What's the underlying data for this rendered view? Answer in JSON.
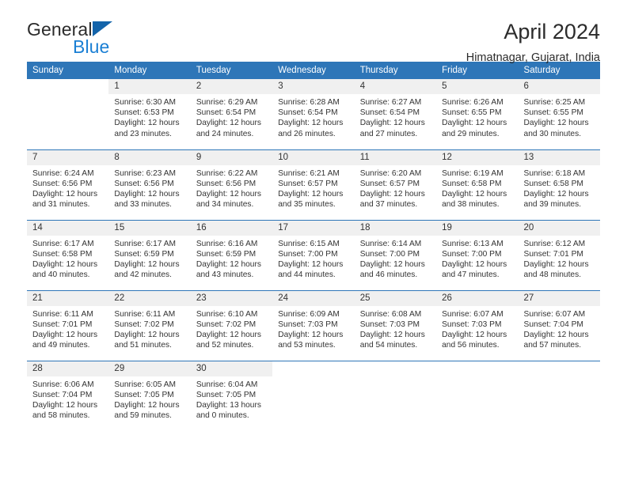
{
  "brand": {
    "name_top": "General",
    "name_bottom": "Blue",
    "triangle_color": "#1464aa",
    "blue_color": "#1a7fd4"
  },
  "header": {
    "title": "April 2024",
    "subtitle": "Himatnagar, Gujarat, India"
  },
  "theme": {
    "header_bg": "#2e76b8",
    "daynum_bg": "#f0f0f0",
    "text": "#333333"
  },
  "weekday_headers": [
    "Sunday",
    "Monday",
    "Tuesday",
    "Wednesday",
    "Thursday",
    "Friday",
    "Saturday"
  ],
  "labels": {
    "sunrise_prefix": "Sunrise:",
    "sunset_prefix": "Sunset:",
    "daylight_prefix": "Daylight:"
  },
  "weeks": [
    [
      {
        "day": ""
      },
      {
        "day": "1",
        "sunrise": "Sunrise: 6:30 AM",
        "sunset": "Sunset: 6:53 PM",
        "daylight_l1": "Daylight: 12 hours",
        "daylight_l2": "and 23 minutes."
      },
      {
        "day": "2",
        "sunrise": "Sunrise: 6:29 AM",
        "sunset": "Sunset: 6:54 PM",
        "daylight_l1": "Daylight: 12 hours",
        "daylight_l2": "and 24 minutes."
      },
      {
        "day": "3",
        "sunrise": "Sunrise: 6:28 AM",
        "sunset": "Sunset: 6:54 PM",
        "daylight_l1": "Daylight: 12 hours",
        "daylight_l2": "and 26 minutes."
      },
      {
        "day": "4",
        "sunrise": "Sunrise: 6:27 AM",
        "sunset": "Sunset: 6:54 PM",
        "daylight_l1": "Daylight: 12 hours",
        "daylight_l2": "and 27 minutes."
      },
      {
        "day": "5",
        "sunrise": "Sunrise: 6:26 AM",
        "sunset": "Sunset: 6:55 PM",
        "daylight_l1": "Daylight: 12 hours",
        "daylight_l2": "and 29 minutes."
      },
      {
        "day": "6",
        "sunrise": "Sunrise: 6:25 AM",
        "sunset": "Sunset: 6:55 PM",
        "daylight_l1": "Daylight: 12 hours",
        "daylight_l2": "and 30 minutes."
      }
    ],
    [
      {
        "day": "7",
        "sunrise": "Sunrise: 6:24 AM",
        "sunset": "Sunset: 6:56 PM",
        "daylight_l1": "Daylight: 12 hours",
        "daylight_l2": "and 31 minutes."
      },
      {
        "day": "8",
        "sunrise": "Sunrise: 6:23 AM",
        "sunset": "Sunset: 6:56 PM",
        "daylight_l1": "Daylight: 12 hours",
        "daylight_l2": "and 33 minutes."
      },
      {
        "day": "9",
        "sunrise": "Sunrise: 6:22 AM",
        "sunset": "Sunset: 6:56 PM",
        "daylight_l1": "Daylight: 12 hours",
        "daylight_l2": "and 34 minutes."
      },
      {
        "day": "10",
        "sunrise": "Sunrise: 6:21 AM",
        "sunset": "Sunset: 6:57 PM",
        "daylight_l1": "Daylight: 12 hours",
        "daylight_l2": "and 35 minutes."
      },
      {
        "day": "11",
        "sunrise": "Sunrise: 6:20 AM",
        "sunset": "Sunset: 6:57 PM",
        "daylight_l1": "Daylight: 12 hours",
        "daylight_l2": "and 37 minutes."
      },
      {
        "day": "12",
        "sunrise": "Sunrise: 6:19 AM",
        "sunset": "Sunset: 6:58 PM",
        "daylight_l1": "Daylight: 12 hours",
        "daylight_l2": "and 38 minutes."
      },
      {
        "day": "13",
        "sunrise": "Sunrise: 6:18 AM",
        "sunset": "Sunset: 6:58 PM",
        "daylight_l1": "Daylight: 12 hours",
        "daylight_l2": "and 39 minutes."
      }
    ],
    [
      {
        "day": "14",
        "sunrise": "Sunrise: 6:17 AM",
        "sunset": "Sunset: 6:58 PM",
        "daylight_l1": "Daylight: 12 hours",
        "daylight_l2": "and 40 minutes."
      },
      {
        "day": "15",
        "sunrise": "Sunrise: 6:17 AM",
        "sunset": "Sunset: 6:59 PM",
        "daylight_l1": "Daylight: 12 hours",
        "daylight_l2": "and 42 minutes."
      },
      {
        "day": "16",
        "sunrise": "Sunrise: 6:16 AM",
        "sunset": "Sunset: 6:59 PM",
        "daylight_l1": "Daylight: 12 hours",
        "daylight_l2": "and 43 minutes."
      },
      {
        "day": "17",
        "sunrise": "Sunrise: 6:15 AM",
        "sunset": "Sunset: 7:00 PM",
        "daylight_l1": "Daylight: 12 hours",
        "daylight_l2": "and 44 minutes."
      },
      {
        "day": "18",
        "sunrise": "Sunrise: 6:14 AM",
        "sunset": "Sunset: 7:00 PM",
        "daylight_l1": "Daylight: 12 hours",
        "daylight_l2": "and 46 minutes."
      },
      {
        "day": "19",
        "sunrise": "Sunrise: 6:13 AM",
        "sunset": "Sunset: 7:00 PM",
        "daylight_l1": "Daylight: 12 hours",
        "daylight_l2": "and 47 minutes."
      },
      {
        "day": "20",
        "sunrise": "Sunrise: 6:12 AM",
        "sunset": "Sunset: 7:01 PM",
        "daylight_l1": "Daylight: 12 hours",
        "daylight_l2": "and 48 minutes."
      }
    ],
    [
      {
        "day": "21",
        "sunrise": "Sunrise: 6:11 AM",
        "sunset": "Sunset: 7:01 PM",
        "daylight_l1": "Daylight: 12 hours",
        "daylight_l2": "and 49 minutes."
      },
      {
        "day": "22",
        "sunrise": "Sunrise: 6:11 AM",
        "sunset": "Sunset: 7:02 PM",
        "daylight_l1": "Daylight: 12 hours",
        "daylight_l2": "and 51 minutes."
      },
      {
        "day": "23",
        "sunrise": "Sunrise: 6:10 AM",
        "sunset": "Sunset: 7:02 PM",
        "daylight_l1": "Daylight: 12 hours",
        "daylight_l2": "and 52 minutes."
      },
      {
        "day": "24",
        "sunrise": "Sunrise: 6:09 AM",
        "sunset": "Sunset: 7:03 PM",
        "daylight_l1": "Daylight: 12 hours",
        "daylight_l2": "and 53 minutes."
      },
      {
        "day": "25",
        "sunrise": "Sunrise: 6:08 AM",
        "sunset": "Sunset: 7:03 PM",
        "daylight_l1": "Daylight: 12 hours",
        "daylight_l2": "and 54 minutes."
      },
      {
        "day": "26",
        "sunrise": "Sunrise: 6:07 AM",
        "sunset": "Sunset: 7:03 PM",
        "daylight_l1": "Daylight: 12 hours",
        "daylight_l2": "and 56 minutes."
      },
      {
        "day": "27",
        "sunrise": "Sunrise: 6:07 AM",
        "sunset": "Sunset: 7:04 PM",
        "daylight_l1": "Daylight: 12 hours",
        "daylight_l2": "and 57 minutes."
      }
    ],
    [
      {
        "day": "28",
        "sunrise": "Sunrise: 6:06 AM",
        "sunset": "Sunset: 7:04 PM",
        "daylight_l1": "Daylight: 12 hours",
        "daylight_l2": "and 58 minutes."
      },
      {
        "day": "29",
        "sunrise": "Sunrise: 6:05 AM",
        "sunset": "Sunset: 7:05 PM",
        "daylight_l1": "Daylight: 12 hours",
        "daylight_l2": "and 59 minutes."
      },
      {
        "day": "30",
        "sunrise": "Sunrise: 6:04 AM",
        "sunset": "Sunset: 7:05 PM",
        "daylight_l1": "Daylight: 13 hours",
        "daylight_l2": "and 0 minutes."
      },
      {
        "day": ""
      },
      {
        "day": ""
      },
      {
        "day": ""
      },
      {
        "day": ""
      }
    ]
  ]
}
